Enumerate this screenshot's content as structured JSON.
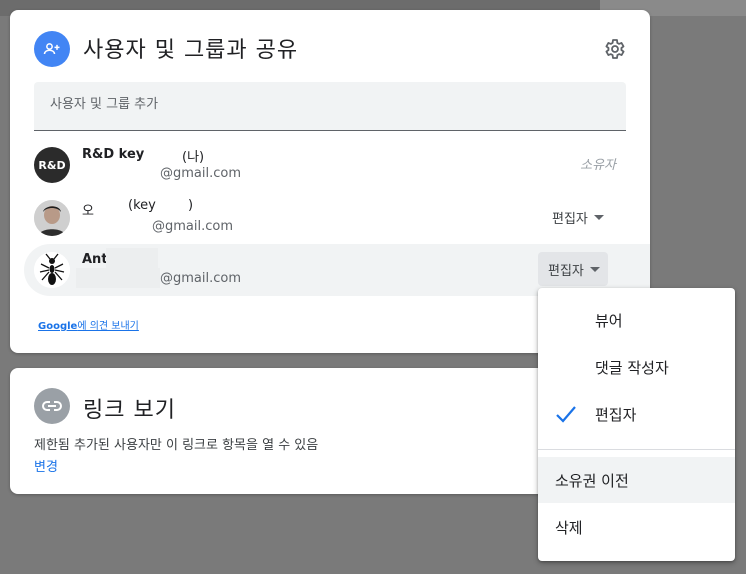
{
  "share_dialog": {
    "title": "사용자 및 그룹과 공유",
    "add_people_placeholder": "사용자 및 그룹 추가",
    "people": [
      {
        "name": "R&D key",
        "suffix": "(나)",
        "email": "@gmail.com",
        "role": "소유자",
        "avatar_text": "R&D"
      },
      {
        "name": "오",
        "suffix": "(key",
        "suffix2": ")",
        "email": "@gmail.com",
        "role": "편집자"
      },
      {
        "name": "Ant",
        "email": "@gmail.com",
        "role": "편집자"
      }
    ],
    "feedback_brand": "Google",
    "feedback_text": "에 의견 보내기"
  },
  "link_card": {
    "title": "링크 보기",
    "description": "제한됨 추가된 사용자만 이 링크로 항목을 열 수 있음",
    "change_label": "변경"
  },
  "role_menu": {
    "items": [
      {
        "label": "뷰어",
        "checked": false
      },
      {
        "label": "댓글 작성자",
        "checked": false
      },
      {
        "label": "편집자",
        "checked": true
      }
    ],
    "secondary": [
      {
        "label": "소유권 이전"
      },
      {
        "label": "삭제"
      }
    ]
  },
  "colors": {
    "accent": "#1a73e8",
    "header_avatar": "#4285f4",
    "link_avatar": "#9aa0a6"
  }
}
